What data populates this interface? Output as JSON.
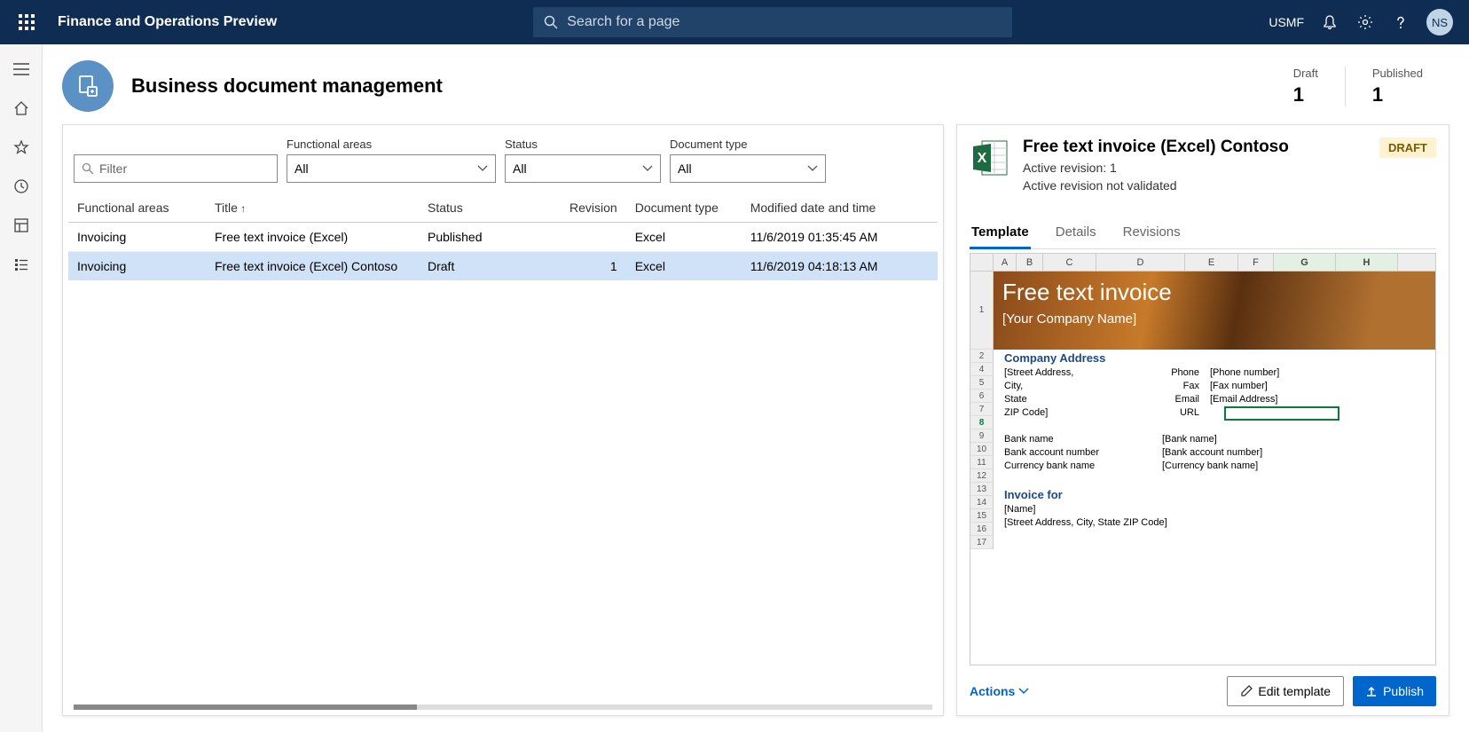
{
  "topbar": {
    "app_title": "Finance and Operations Preview",
    "search_placeholder": "Search for a page",
    "company": "USMF",
    "avatar_initials": "NS"
  },
  "page": {
    "title": "Business document management",
    "stats": [
      {
        "label": "Draft",
        "value": "1"
      },
      {
        "label": "Published",
        "value": "1"
      }
    ]
  },
  "filters": {
    "filter_placeholder": "Filter",
    "functional_label": "Functional areas",
    "functional_value": "All",
    "status_label": "Status",
    "status_value": "All",
    "doctype_label": "Document type",
    "doctype_value": "All"
  },
  "grid": {
    "headers": {
      "functional": "Functional areas",
      "title": "Title",
      "status": "Status",
      "revision": "Revision",
      "doctype": "Document type",
      "modified": "Modified date and time"
    },
    "rows": [
      {
        "functional": "Invoicing",
        "title": "Free text invoice (Excel)",
        "status": "Published",
        "revision": "",
        "doctype": "Excel",
        "modified": "11/6/2019 01:35:45 AM",
        "selected": false
      },
      {
        "functional": "Invoicing",
        "title": "Free text invoice (Excel) Contoso",
        "status": "Draft",
        "revision": "1",
        "doctype": "Excel",
        "modified": "11/6/2019 04:18:13 AM",
        "selected": true
      }
    ]
  },
  "detail": {
    "title": "Free text invoice (Excel) Contoso",
    "active_revision": "Active revision: 1",
    "validation": "Active revision not validated",
    "badge": "DRAFT",
    "tabs": {
      "template": "Template",
      "details": "Details",
      "revisions": "Revisions"
    },
    "actions_label": "Actions",
    "edit_label": "Edit template",
    "publish_label": "Publish"
  },
  "preview": {
    "columns": [
      "A",
      "B",
      "C",
      "D",
      "E",
      "F",
      "G",
      "H"
    ],
    "row_nums": [
      "1",
      "2",
      "4",
      "5",
      "6",
      "7",
      "8",
      "9",
      "10",
      "11",
      "12",
      "13",
      "14",
      "15",
      "16",
      "17"
    ],
    "banner_title": "Free text invoice",
    "banner_sub": "[Your Company Name]",
    "company_address_head": "Company Address",
    "addr_lines": [
      "[Street Address,",
      "City,",
      "State",
      "ZIP Code]"
    ],
    "contact_rows": [
      {
        "fld": "Phone",
        "val": "[Phone number]"
      },
      {
        "fld": "Fax",
        "val": "[Fax number]"
      },
      {
        "fld": "Email",
        "val": "[Email Address]"
      },
      {
        "fld": "URL",
        "val": ""
      }
    ],
    "bank_rows": [
      {
        "lbl": "Bank name",
        "val": "[Bank name]"
      },
      {
        "lbl": "Bank account number",
        "val": "[Bank account number]"
      },
      {
        "lbl": "Currency bank name",
        "val": "[Currency bank name]"
      }
    ],
    "invoice_for_head": "Invoice for",
    "invoice_for_rows": [
      "[Name]",
      "[Street Address, City, State ZIP Code]"
    ]
  }
}
